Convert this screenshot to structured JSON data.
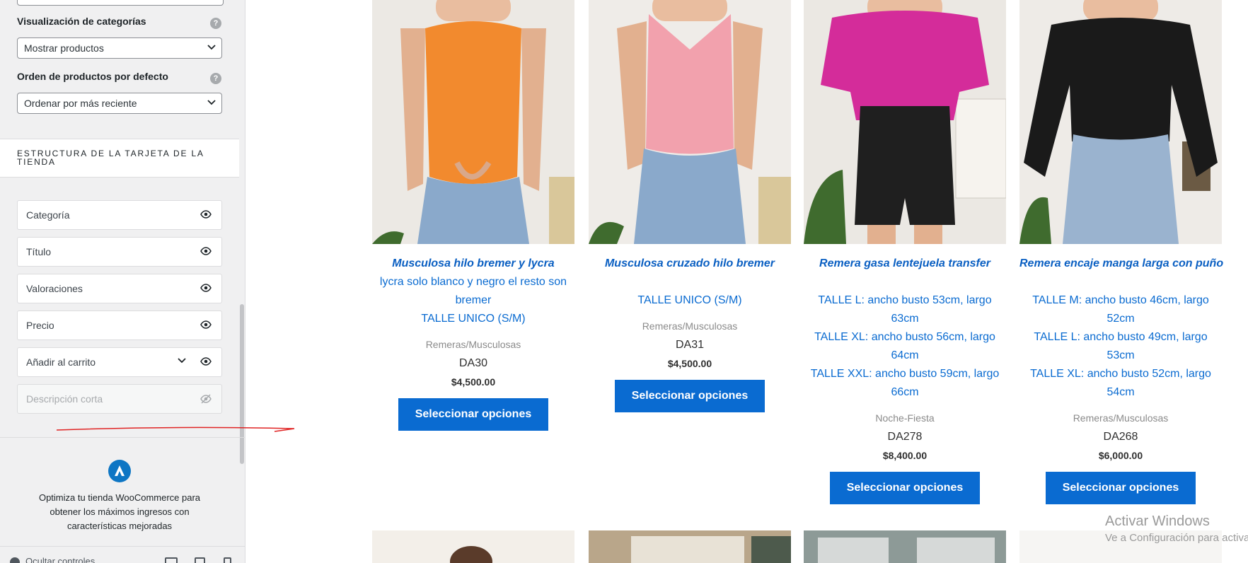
{
  "sidebar": {
    "category_display": {
      "label": "Visualización de categorías",
      "value": "Mostrar productos"
    },
    "default_order": {
      "label": "Orden de productos por defecto",
      "value": "Ordenar por más reciente"
    },
    "help_glyph": "?",
    "section_title": "ESTRUCTURA DE LA TARJETA DE LA TIENDA",
    "structure_items": [
      {
        "label": "Categoría",
        "visible": true
      },
      {
        "label": "Título",
        "visible": true
      },
      {
        "label": "Valoraciones",
        "visible": true
      },
      {
        "label": "Precio",
        "visible": true
      },
      {
        "label": "Añadir al carrito",
        "visible": true,
        "expandable": true
      },
      {
        "label": "Descripción corta",
        "visible": false
      }
    ],
    "promo_text": "Optimiza tu tienda WooCommerce para obtener los máximos ingresos con características mejoradas",
    "hide_controls": "Ocultar controles"
  },
  "products": [
    {
      "title": "Musculosa hilo bremer y lycra",
      "description": [
        "lycra solo blanco y negro el resto son",
        "bremer",
        "TALLE UNICO (S/M)"
      ],
      "category": "Remeras/Musculosas",
      "sku": "DA30",
      "price": "$4,500.00",
      "button": "Seleccionar opciones",
      "garment_color": "#f28a2e"
    },
    {
      "title": "Musculosa cruzado hilo bremer",
      "description": [
        "",
        "TALLE UNICO (S/M)"
      ],
      "category": "Remeras/Musculosas",
      "sku": "DA31",
      "price": "$4,500.00",
      "button": "Seleccionar opciones",
      "garment_color": "#f2a1ad"
    },
    {
      "title": "Remera gasa lentejuela transfer",
      "description": [
        "",
        "TALLE L: ancho busto 53cm, largo 63cm",
        "TALLE XL: ancho busto 56cm, largo",
        "64cm",
        "TALLE XXL: ancho busto 59cm, largo",
        "66cm"
      ],
      "category": "Noche-Fiesta",
      "sku": "DA278",
      "price": "$8,400.00",
      "button": "Seleccionar opciones",
      "garment_color": "#d42c9a"
    },
    {
      "title": "Remera encaje manga larga con puño",
      "description": [
        "",
        "TALLE M: ancho busto 46cm, largo 52cm",
        "TALLE L: ancho busto 49cm, largo 53cm",
        "TALLE XL: ancho busto 52cm, largo",
        "54cm"
      ],
      "category": "Remeras/Musculosas",
      "sku": "DA268",
      "price": "$6,000.00",
      "button": "Seleccionar opciones",
      "garment_color": "#1a1a1a"
    }
  ],
  "watermark": {
    "title": "Activar Windows",
    "subtitle": "Ve a Configuración para activar"
  }
}
